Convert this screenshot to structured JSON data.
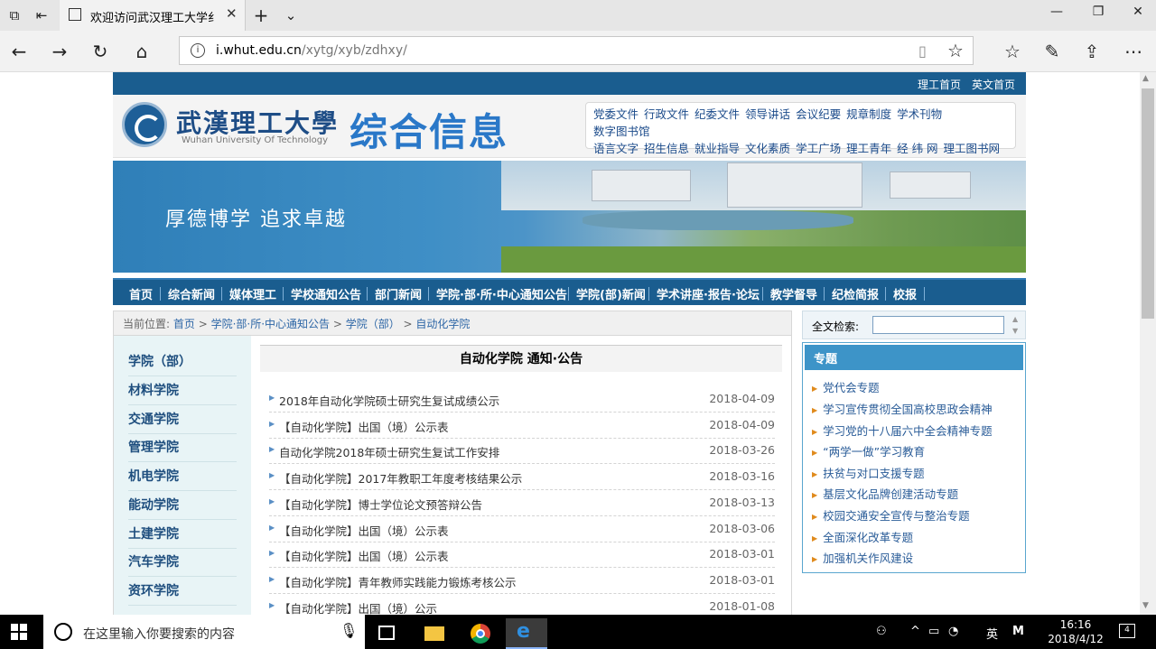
{
  "browser": {
    "tab_title": "欢迎访问武汉理工大学纟",
    "url_host": "i.whut.edu.cn",
    "url_path": "/xytg/xyb/zdhxy/"
  },
  "site": {
    "top_links": [
      "理工首页",
      "英文首页"
    ],
    "logo_cn": "武漢理工大學",
    "logo_en": "Wuhan University Of Technology",
    "logo_title": "综合信息",
    "quick_links_row1": [
      "党委文件",
      "行政文件",
      "纪委文件",
      "领导讲话",
      "会议纪要",
      "规章制度",
      "学术刊物",
      "数字图书馆"
    ],
    "quick_links_row2": [
      "语言文字",
      "招生信息",
      "就业指导",
      "文化素质",
      "学工广场",
      "理工青年",
      "经 纬 网",
      "理工图书网"
    ],
    "slogan": "厚德博学  追求卓越",
    "main_nav": [
      "首页",
      "综合新闻",
      "媒体理工",
      "学校通知公告",
      "部门新闻",
      "学院·部·所·中心通知公告",
      "学院(部)新闻",
      "学术讲座·报告·论坛",
      "教学督导",
      "纪检简报",
      "校报"
    ]
  },
  "breadcrumb": {
    "prefix": "当前位置:",
    "items": [
      "首页",
      "学院·部·所·中心通知公告",
      "学院（部）",
      "自动化学院"
    ]
  },
  "left_menu": [
    "学院（部）",
    "材料学院",
    "交通学院",
    "管理学院",
    "机电学院",
    "能动学院",
    "土建学院",
    "汽车学院",
    "资环学院"
  ],
  "notices": {
    "title": "自动化学院  通知·公告",
    "items": [
      {
        "title": "2018年自动化学院硕士研究生复试成绩公示",
        "date": "2018-04-09"
      },
      {
        "title": "【自动化学院】出国（境）公示表",
        "date": "2018-04-09"
      },
      {
        "title": "自动化学院2018年硕士研究生复试工作安排",
        "date": "2018-03-26"
      },
      {
        "title": "【自动化学院】2017年教职工年度考核结果公示",
        "date": "2018-03-16"
      },
      {
        "title": "【自动化学院】博士学位论文预答辩公告",
        "date": "2018-03-13"
      },
      {
        "title": "【自动化学院】出国（境）公示表",
        "date": "2018-03-06"
      },
      {
        "title": "【自动化学院】出国（境）公示表",
        "date": "2018-03-01"
      },
      {
        "title": "【自动化学院】青年教师实践能力锻炼考核公示",
        "date": "2018-03-01"
      },
      {
        "title": "【自动化学院】出国（境）公示",
        "date": "2018-01-08"
      }
    ]
  },
  "search": {
    "label": "全文检索:"
  },
  "topics": {
    "header": "专题",
    "items": [
      "党代会专题",
      "学习宣传贯彻全国高校思政会精神",
      "学习党的十八届六中全会精神专题",
      "“两学一做”学习教育",
      "扶贫与对口支援专题",
      "基层文化品牌创建活动专题",
      "校园交通安全宣传与整治专题",
      "全面深化改革专题",
      "加强机关作风建设"
    ]
  },
  "taskbar": {
    "search_placeholder": "在这里输入你要搜索的内容",
    "ime": "英",
    "ime2": "M",
    "time": "16:16",
    "date": "2018/4/12",
    "notifications": "4"
  }
}
